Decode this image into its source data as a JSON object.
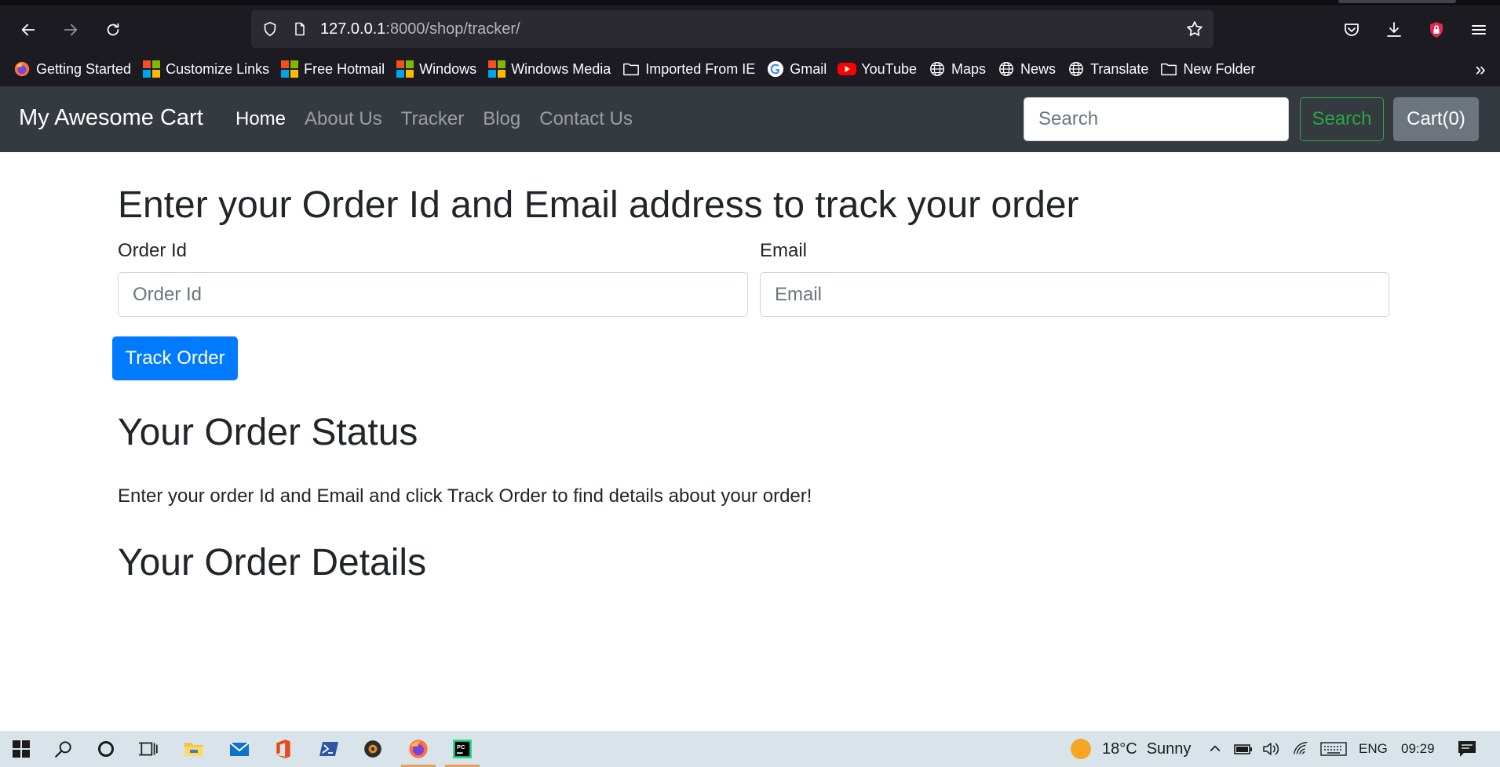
{
  "browser": {
    "url_host": "127.0.0.1",
    "url_rest": ":8000/shop/tracker/",
    "bookmarks": [
      {
        "label": "Getting Started",
        "icon": "firefox-icon"
      },
      {
        "label": "Customize Links",
        "icon": "windows-logo-icon"
      },
      {
        "label": "Free Hotmail",
        "icon": "windows-logo-icon"
      },
      {
        "label": "Windows",
        "icon": "windows-logo-icon"
      },
      {
        "label": "Windows Media",
        "icon": "windows-logo-icon"
      },
      {
        "label": "Imported From IE",
        "icon": "folder-icon"
      },
      {
        "label": "Gmail",
        "icon": "google-icon"
      },
      {
        "label": "YouTube",
        "icon": "youtube-icon"
      },
      {
        "label": "Maps",
        "icon": "globe-icon"
      },
      {
        "label": "News",
        "icon": "globe-icon"
      },
      {
        "label": "Translate",
        "icon": "globe-icon"
      },
      {
        "label": "New Folder",
        "icon": "folder-icon"
      }
    ]
  },
  "navbar": {
    "brand": "My Awesome Cart",
    "links": [
      "Home",
      "About Us",
      "Tracker",
      "Blog",
      "Contact Us"
    ],
    "active_link": "Home",
    "search_placeholder": "Search",
    "search_button": "Search",
    "cart_button": "Cart(0)"
  },
  "tracker": {
    "heading": "Enter your Order Id and Email address to track your order",
    "order_id_label": "Order Id",
    "order_id_placeholder": "Order Id",
    "email_label": "Email",
    "email_placeholder": "Email",
    "track_button": "Track Order"
  },
  "status": {
    "heading": "Your Order Status",
    "message": "Enter your order Id and Email and click Track Order to find details about your order!"
  },
  "details": {
    "heading": "Your Order Details"
  },
  "taskbar": {
    "weather_temp": "18°C",
    "weather_text": "Sunny",
    "language": "ENG",
    "time": "09:29"
  },
  "colors": {
    "navbar_bg": "#343a40",
    "primary": "#007bff",
    "success": "#28a745",
    "secondary": "#6c757d"
  }
}
